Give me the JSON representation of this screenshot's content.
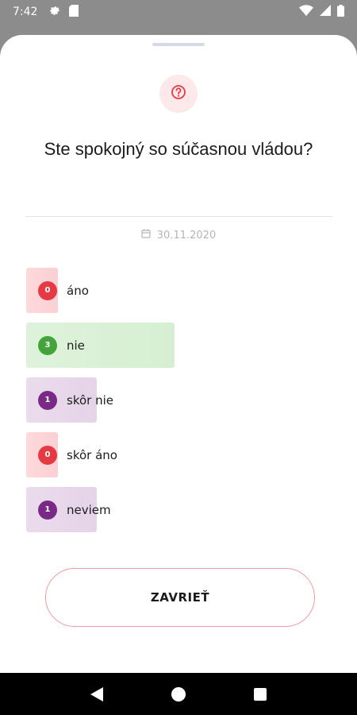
{
  "status_bar": {
    "time": "7:42",
    "icons": [
      "settings-icon",
      "sim-card-icon",
      "wifi-icon",
      "cell-signal-icon",
      "battery-icon"
    ]
  },
  "poll": {
    "icon": "question-circle-icon",
    "title": "Ste spokojný so súčasnou vládou?",
    "date": "30.11.2020",
    "total_votes_max": 3,
    "answers": [
      {
        "label": "áno",
        "count": "0",
        "share": 0,
        "color": "#e53944",
        "bar_color": "#fbd0d3"
      },
      {
        "label": "nie",
        "count": "3",
        "share": 1.0,
        "color": "#44a33b",
        "bar_color": "#d6efd2"
      },
      {
        "label": "skôr nie",
        "count": "1",
        "share": 0.333,
        "color": "#7a2a86",
        "bar_color": "#e5d3e8"
      },
      {
        "label": "skôr áno",
        "count": "0",
        "share": 0,
        "color": "#e53944",
        "bar_color": "#fbd0d3"
      },
      {
        "label": "neviem",
        "count": "1",
        "share": 0.333,
        "color": "#7a2a86",
        "bar_color": "#e5d3e8"
      }
    ]
  },
  "close_button": {
    "label": "ZAVRIEŤ"
  },
  "colors": {
    "accent_red": "#e53944",
    "button_border": "#ef9aa1",
    "icon_bg": "#fde8ea"
  },
  "nav": {
    "items": [
      "back-icon",
      "home-icon",
      "recents-icon"
    ]
  }
}
